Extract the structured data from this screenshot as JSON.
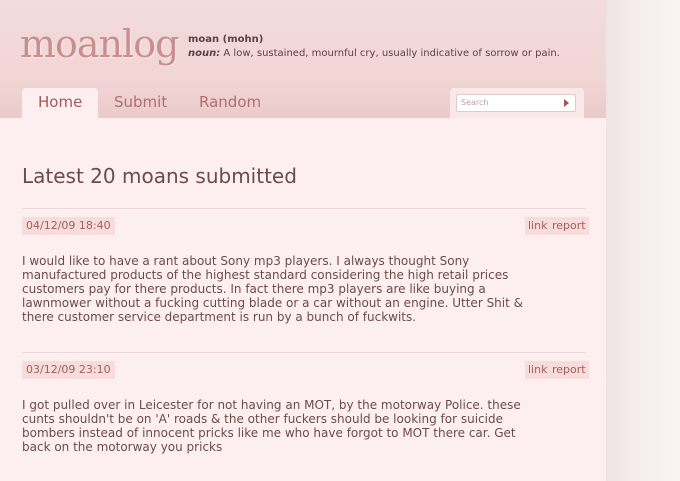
{
  "site": {
    "logo": "moanlog",
    "definition_word": "moan (mohn)",
    "definition_pos": "noun:",
    "definition_text": " A low, sustained, mournful cry, usually indicative of sorrow or pain."
  },
  "nav": {
    "tabs": [
      {
        "label": "Home"
      },
      {
        "label": "Submit"
      },
      {
        "label": "Random"
      }
    ]
  },
  "search": {
    "placeholder": "Search"
  },
  "main": {
    "heading": "Latest 20 moans submitted",
    "moans": [
      {
        "date": "04/12/09 18:40",
        "link_label": "link",
        "report_label": "report",
        "text": "I would like to have a rant about Sony mp3 players. I always thought Sony manufactured products of the highest standard considering the high retail prices customers pay for there products. In fact there mp3 players are like buying a lawnmower without a fucking cutting blade or a car without an engine. Utter Shit & there customer service department is run by a bunch of fuckwits."
      },
      {
        "date": "03/12/09 23:10",
        "link_label": "link",
        "report_label": "report",
        "text": "I got pulled over in Leicester for not having an MOT, by the motorway Police. these cunts shouldn't be on 'A' roads & the other fuckers should be looking for suicide bombers instead of innocent pricks like me who have forgot to MOT there car. Get back on the motorway you pricks"
      }
    ]
  },
  "colors": {
    "accent": "#b06f6f",
    "badge_bg": "#f7dcdc",
    "page_bg": "#fdeff0"
  }
}
